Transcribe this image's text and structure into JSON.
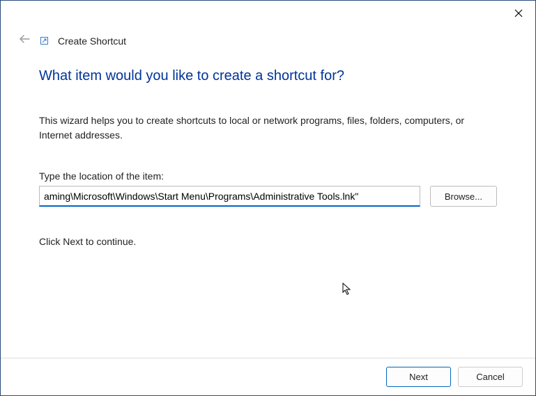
{
  "window": {
    "title": "Create Shortcut"
  },
  "heading": "What item would you like to create a shortcut for?",
  "description": "This wizard helps you to create shortcuts to local or network programs, files, folders, computers, or Internet addresses.",
  "field": {
    "label": "Type the location of the item:",
    "value": "aming\\Microsoft\\Windows\\Start Menu\\Programs\\Administrative Tools.lnk\""
  },
  "buttons": {
    "browse": "Browse...",
    "next": "Next",
    "cancel": "Cancel"
  },
  "continue_text": "Click Next to continue."
}
